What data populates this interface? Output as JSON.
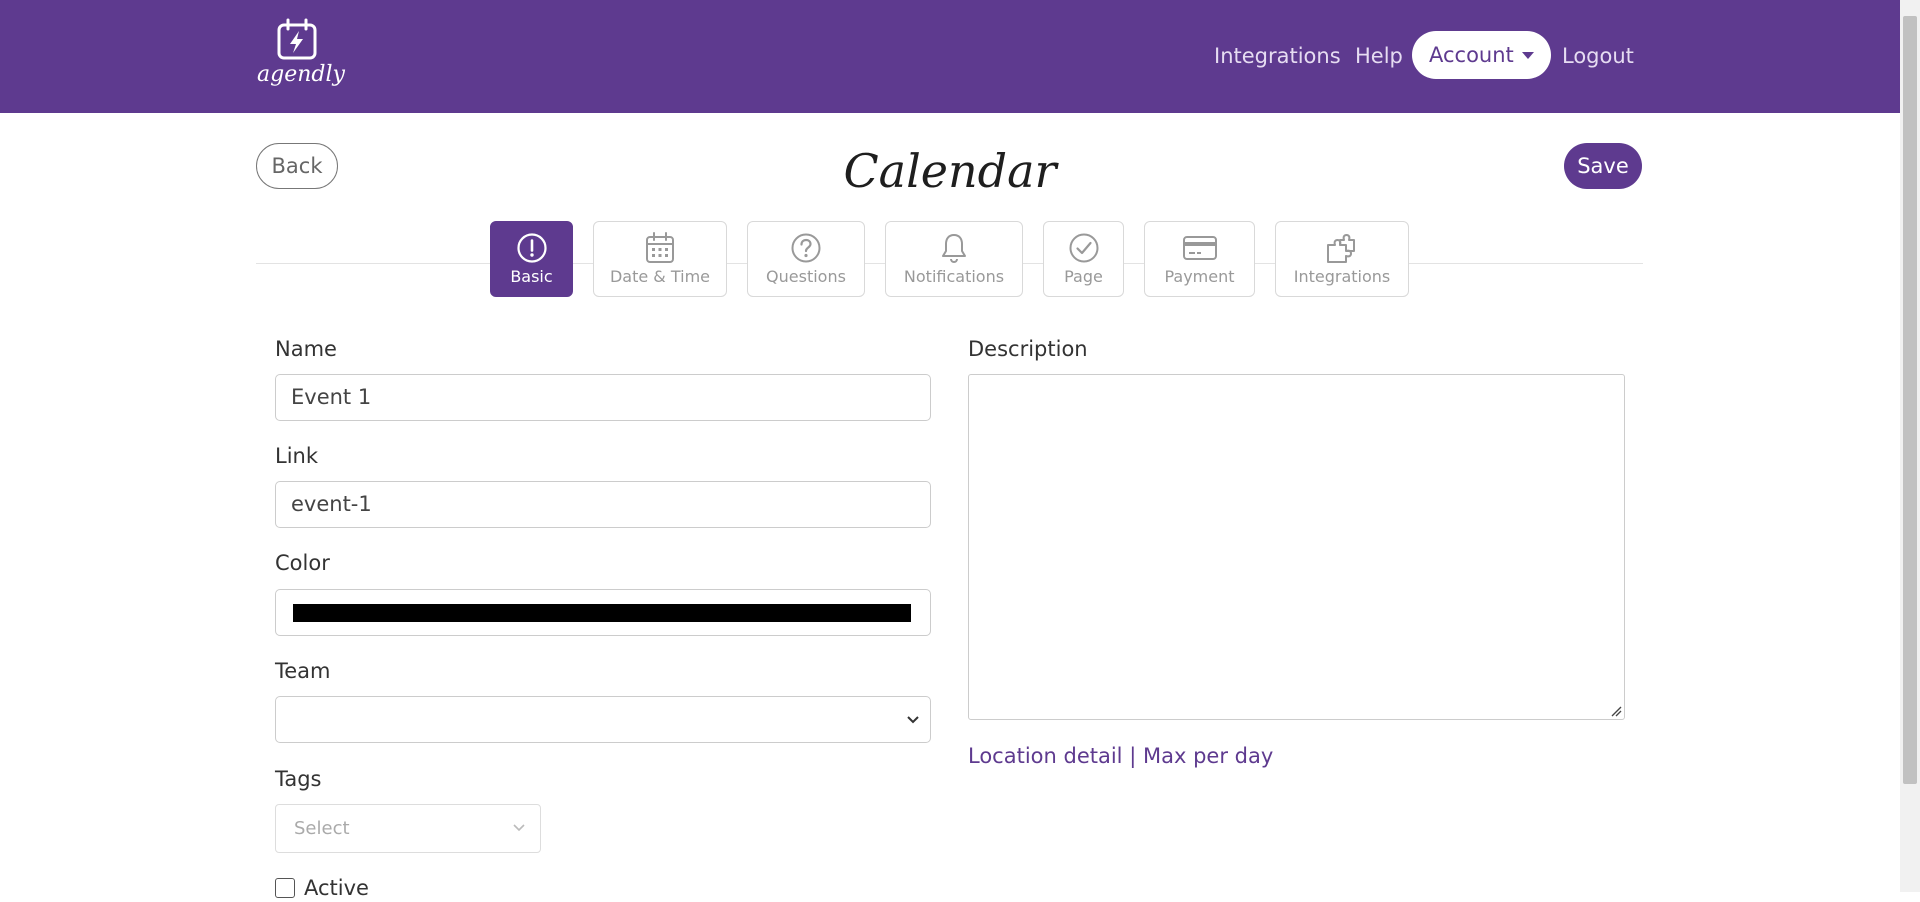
{
  "brand": {
    "logo_text": "agendly",
    "color": "#5e3a8f"
  },
  "nav": {
    "integrations": "Integrations",
    "help": "Help",
    "account": "Account",
    "logout": "Logout"
  },
  "header": {
    "back": "Back",
    "title": "Calendar",
    "save": "Save"
  },
  "tabs": [
    {
      "label": "Basic",
      "icon": "exclamation-circle-icon",
      "active": true
    },
    {
      "label": "Date & Time",
      "icon": "calendar-icon",
      "active": false
    },
    {
      "label": "Questions",
      "icon": "question-circle-icon",
      "active": false
    },
    {
      "label": "Notifications",
      "icon": "bell-icon",
      "active": false
    },
    {
      "label": "Page",
      "icon": "check-circle-icon",
      "active": false
    },
    {
      "label": "Payment",
      "icon": "credit-card-icon",
      "active": false
    },
    {
      "label": "Integrations",
      "icon": "puzzle-icon",
      "active": false
    }
  ],
  "form": {
    "name_label": "Name",
    "name_value": "Event 1",
    "link_label": "Link",
    "link_value": "event-1",
    "color_label": "Color",
    "color_value": "#000000",
    "team_label": "Team",
    "team_value": "",
    "tags_label": "Tags",
    "tags_placeholder": "Select",
    "active_label": "Active",
    "active_checked": false,
    "description_label": "Description",
    "description_value": "",
    "location_detail_link": "Location detail",
    "separator": "|",
    "max_per_day_link": "Max per day"
  }
}
